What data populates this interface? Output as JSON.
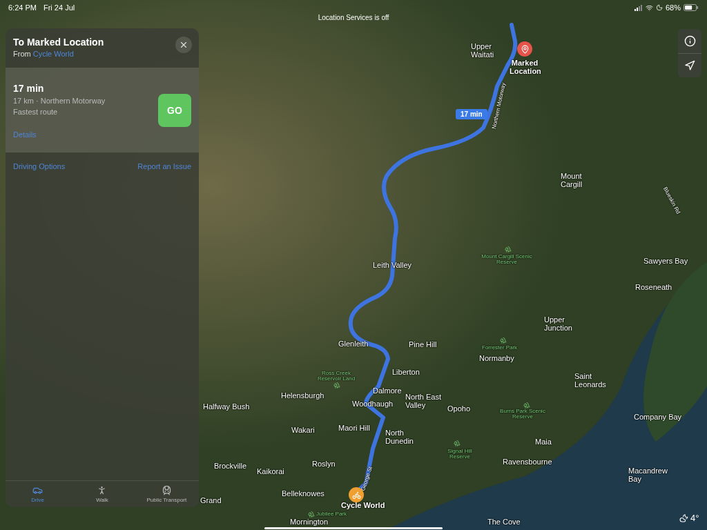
{
  "status_bar": {
    "time": "6:24 PM",
    "date": "Fri 24 Jul",
    "notice": "Location Services is off",
    "battery": "68%"
  },
  "directions_panel": {
    "title": "To Marked Location",
    "from_label": "From",
    "from_place": "Cycle World",
    "route": {
      "duration": "17 min",
      "summary": "17 km · Northern Motorway",
      "note": "Fastest route",
      "details_link": "Details",
      "go_button": "GO"
    },
    "links": [
      "Driving Options",
      "Report an Issue"
    ],
    "modes": [
      {
        "label": "Drive",
        "kind": "car",
        "selected": true
      },
      {
        "label": "Walk",
        "kind": "walk",
        "selected": false
      },
      {
        "label": "Public Transport",
        "kind": "train",
        "selected": false
      }
    ]
  },
  "map": {
    "route_badge": "17 min",
    "weather": "4°",
    "labels": [
      {
        "text": "Upper Waitati",
        "kind": "place"
      },
      {
        "text": "Marked Location",
        "kind": "pin"
      },
      {
        "text": "Northern Motorway",
        "kind": "road"
      },
      {
        "text": "Mount Cargill",
        "kind": "place"
      },
      {
        "text": "Blueskin Rd",
        "kind": "road"
      },
      {
        "text": "Mount Cargill Scenic Reserve",
        "kind": "park"
      },
      {
        "text": "Leith Valley",
        "kind": "place"
      },
      {
        "text": "Sawyers Bay",
        "kind": "place"
      },
      {
        "text": "Roseneath",
        "kind": "place"
      },
      {
        "text": "Upper Junction",
        "kind": "place"
      },
      {
        "text": "Forrester Park",
        "kind": "park"
      },
      {
        "text": "Glenleith",
        "kind": "place"
      },
      {
        "text": "Pine Hill",
        "kind": "place"
      },
      {
        "text": "Normanby",
        "kind": "place"
      },
      {
        "text": "Liberton",
        "kind": "place"
      },
      {
        "text": "Ross Creek Reservoir Land",
        "kind": "park"
      },
      {
        "text": "Saint Leonards",
        "kind": "place"
      },
      {
        "text": "Dalmore",
        "kind": "place"
      },
      {
        "text": "Helensburgh",
        "kind": "place"
      },
      {
        "text": "Halfway Bush",
        "kind": "place"
      },
      {
        "text": "Woodhaugh",
        "kind": "place"
      },
      {
        "text": "North East Valley",
        "kind": "place"
      },
      {
        "text": "Opoho",
        "kind": "place"
      },
      {
        "text": "Burns Park Scenic Reserve",
        "kind": "park"
      },
      {
        "text": "Company Bay",
        "kind": "place"
      },
      {
        "text": "Wakari",
        "kind": "place"
      },
      {
        "text": "Maori Hill",
        "kind": "place"
      },
      {
        "text": "North Dunedin",
        "kind": "place"
      },
      {
        "text": "Signal Hill Reserve",
        "kind": "park"
      },
      {
        "text": "Maia",
        "kind": "place"
      },
      {
        "text": "Brockville",
        "kind": "place"
      },
      {
        "text": "Kaikorai",
        "kind": "place"
      },
      {
        "text": "Roslyn",
        "kind": "place"
      },
      {
        "text": "Ravensbourne",
        "kind": "place"
      },
      {
        "text": "Macandrew Bay",
        "kind": "place"
      },
      {
        "text": "George St",
        "kind": "road"
      },
      {
        "text": "Grand",
        "kind": "place"
      },
      {
        "text": "Belleknowes",
        "kind": "place"
      },
      {
        "text": "Cycle World",
        "kind": "start"
      },
      {
        "text": "Jubilee Park",
        "kind": "park"
      },
      {
        "text": "Mornington",
        "kind": "place"
      },
      {
        "text": "The Cove",
        "kind": "place"
      }
    ]
  }
}
